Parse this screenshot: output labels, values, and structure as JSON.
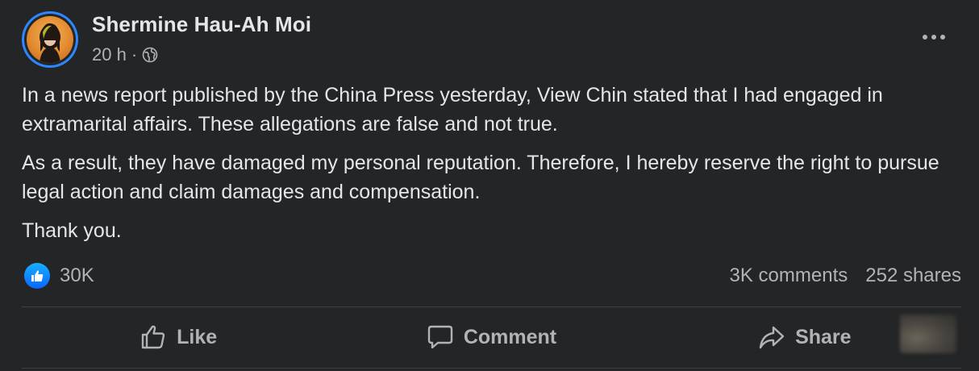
{
  "author": {
    "name": "Shermine Hau-Ah Moi",
    "time": "20 h",
    "separator": "·",
    "privacy_icon": "globe-icon"
  },
  "post": {
    "paragraphs": [
      "In a news report published by the China Press yesterday, View Chin stated that I had engaged in extramarital affairs. These allegations are false and not true.",
      "As a result, they have damaged my personal reputation. Therefore, I hereby reserve the right to pursue legal action and claim damages and compensation.",
      "Thank you."
    ]
  },
  "engagement": {
    "reaction_icon": "like-reaction-icon",
    "reactions": "30K",
    "comments": "3K comments",
    "shares": "252 shares"
  },
  "actions": {
    "like": "Like",
    "comment": "Comment",
    "share": "Share"
  },
  "colors": {
    "background": "#242526",
    "primary_text": "#e4e6eb",
    "secondary_text": "#b0b3b8",
    "accent_blue": "#0866ff",
    "divider": "#3e4042"
  }
}
